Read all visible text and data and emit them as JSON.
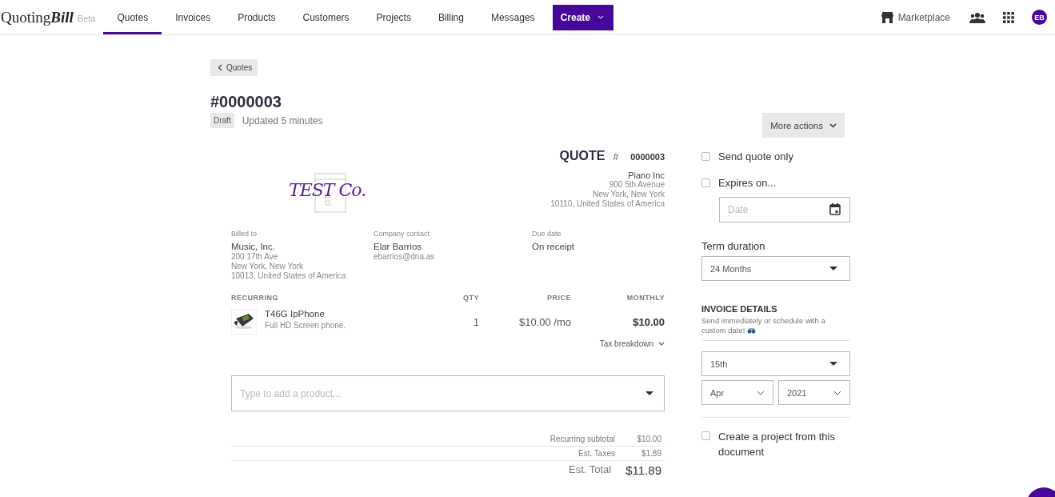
{
  "nav": {
    "brand": "Quoting**Bill**",
    "badge": "Beta",
    "tabs": [
      {
        "label": "Quotes",
        "selected": true
      },
      {
        "label": "Invoices",
        "selected": false
      },
      {
        "label": "Products",
        "selected": false
      },
      {
        "label": "Customers",
        "selected": false
      },
      {
        "label": "Projects",
        "selected": false
      },
      {
        "label": "Billing",
        "selected": false
      },
      {
        "label": "Messages",
        "selected": false
      }
    ],
    "create_button": "Create",
    "marketplace": "Marketplace",
    "avatar": "EB"
  },
  "back_button": "Quotes",
  "quote": {
    "number": "#0000003",
    "status": "Draft",
    "updated": "Updated 5 minutes",
    "more_actions": "More actions"
  },
  "document": {
    "logo_text": "TEST Co.",
    "heading": "QUOTE",
    "hash": "#",
    "number": "0000003",
    "company": [
      "Piano Inc",
      "900 5th Avenue",
      "New York, New York",
      "10110, United States of America"
    ],
    "parties": [
      {
        "label": "Billed to",
        "name": "Music, Inc.",
        "lines": [
          "200 17th Ave",
          "New York, New York",
          "10013, United States of America"
        ]
      },
      {
        "label": "Company contact",
        "name": "Elar Barrios",
        "lines": [
          "ebarrios@dna.as"
        ]
      },
      {
        "label": "Due date",
        "name": "On receipt"
      }
    ],
    "columns": [
      "RECURRING",
      "QTY",
      "PRICE",
      "MONTHLY"
    ],
    "rows": [
      {
        "name": "T46G IpPhone",
        "description": "Full HD Screen phone.",
        "qty": "1",
        "price": "$10.00 /mo",
        "total": "$10.00"
      }
    ],
    "tax_breakdown": "Tax breakdown",
    "product_search": {
      "placeholder": "Type to add a product..."
    },
    "totals": [
      {
        "label": "Recurring subtotal",
        "value": "$10.00",
        "kind": "line"
      },
      {
        "label": "Est. Taxes",
        "value": "$1.89",
        "kind": "line"
      },
      {
        "label": "Est. Total",
        "value": "$11.89",
        "kind": "grand"
      }
    ]
  },
  "options": {
    "send_quote_only": {
      "label": "Send quote only",
      "checked": false
    },
    "expires": {
      "label": "Expires on...",
      "checked": false
    },
    "date": {
      "placeholder": "Date"
    },
    "term": {
      "label": "Term duration",
      "value": "24 Months"
    },
    "invoice": {
      "heading": "INVOICE DETAILS",
      "note": "Send immediately or schedule with a custom date!",
      "day": "15th",
      "month": "Apr",
      "year": "2021"
    },
    "project": {
      "label": "Create a project from this document",
      "checked": false
    }
  }
}
